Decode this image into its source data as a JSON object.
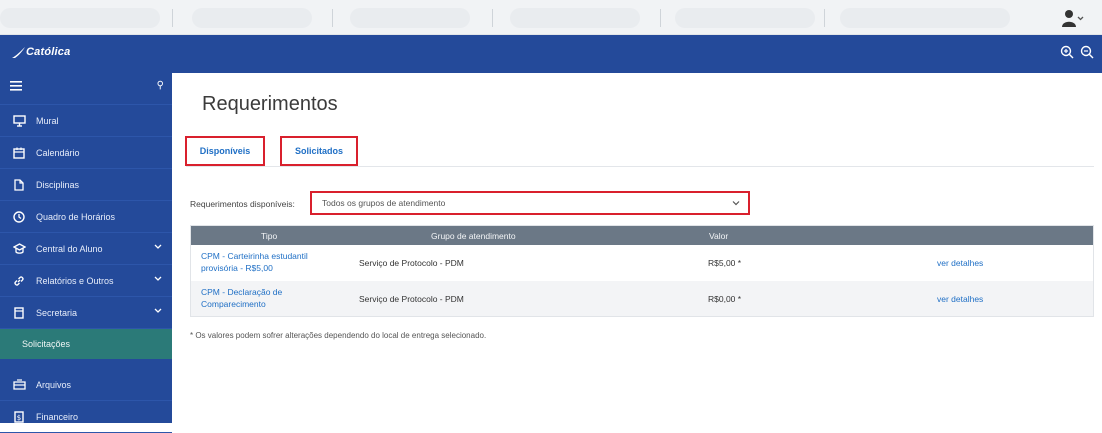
{
  "header": {
    "logo_text": "Católica"
  },
  "sidebar": {
    "items": [
      {
        "label": "Mural",
        "icon": "monitor-icon"
      },
      {
        "label": "Calendário",
        "icon": "calendar-icon"
      },
      {
        "label": "Disciplinas",
        "icon": "books-icon"
      },
      {
        "label": "Quadro de Horários",
        "icon": "clock-icon"
      },
      {
        "label": "Central do Aluno",
        "icon": "student-icon"
      },
      {
        "label": "Relatórios e Outros",
        "icon": "link-icon"
      },
      {
        "label": "Secretaria",
        "icon": "folder-icon"
      },
      {
        "label": "Arquivos",
        "icon": "cloud-icon"
      },
      {
        "label": "Financeiro",
        "icon": "money-icon"
      }
    ],
    "active_sub": "Solicitações"
  },
  "main": {
    "title": "Requerimentos",
    "tabs": [
      {
        "label": "Disponíveis"
      },
      {
        "label": "Solicitados"
      }
    ],
    "filter": {
      "label": "Requerimentos disponíveis:",
      "selected": "Todos os grupos de atendimento"
    },
    "table": {
      "columns": [
        "Tipo",
        "Grupo de atendimento",
        "Valor",
        ""
      ],
      "rows": [
        {
          "tipo": "CPM - Carteirinha estudantil provisória - R$5,00",
          "grupo": "Serviço de Protocolo - PDM",
          "valor": "R$5,00 *",
          "action": "ver detalhes"
        },
        {
          "tipo": "CPM - Declaração de Comparecimento",
          "grupo": "Serviço de Protocolo - PDM",
          "valor": "R$0,00 *",
          "action": "ver detalhes"
        }
      ]
    },
    "note": "* Os valores podem sofrer alterações dependendo do local de entrega selecionado."
  },
  "colors": {
    "primary_blue": "#244a9a",
    "active_teal": "#2b7a78",
    "link_blue": "#1f6fc5",
    "highlight_red": "#d9202d",
    "table_header": "#6b7886"
  }
}
